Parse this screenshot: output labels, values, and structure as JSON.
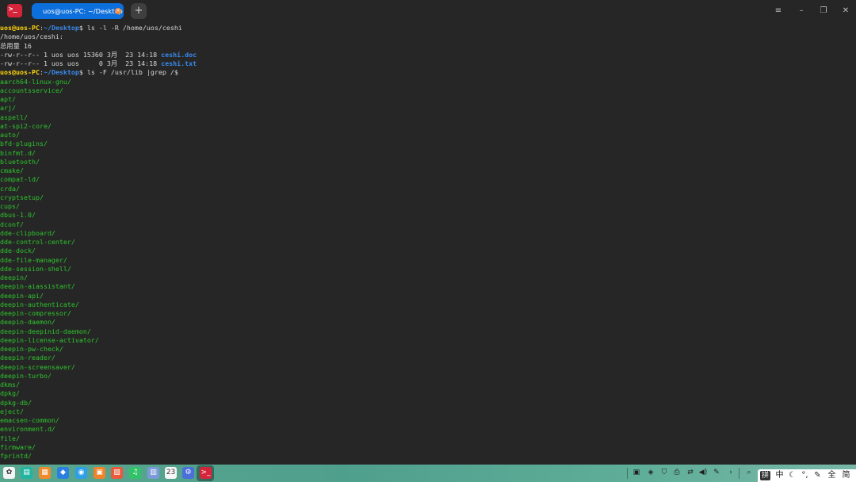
{
  "titlebar": {
    "tab_title": "uos@uos-PC: ~/Desktop",
    "new_tab_symbol": "+",
    "menu_symbol": "≡",
    "minimize_symbol": "–",
    "restore_symbol": "❐",
    "close_symbol": "✕",
    "app_icon_glyph": ">_",
    "tab_close_glyph": "×"
  },
  "terminal": {
    "prompt_user": "uos@uos-PC",
    "prompt_sep": ":",
    "prompt_path": "~/Desktop",
    "prompt_dollar": "$ ",
    "command_1": "ls -l -R /home/uos/ceshi",
    "dir_header": "/home/uos/ceshi:",
    "total_line": "总用量 16",
    "file_1_meta": "-rw-r--r-- 1 uos uos 15360 3月  23 14:18 ",
    "file_1_name": "ceshi.doc",
    "file_2_meta": "-rw-r--r-- 1 uos uos     0 3月  23 14:18 ",
    "file_2_name": "ceshi.txt",
    "command_2": "ls -F /usr/lib |grep /$",
    "dir_entries": [
      "aarch64-linux-gnu/",
      "accountsservice/",
      "apt/",
      "arj/",
      "aspell/",
      "at-spi2-core/",
      "auto/",
      "bfd-plugins/",
      "binfmt.d/",
      "bluetooth/",
      "cmake/",
      "compat-ld/",
      "crda/",
      "cryptsetup/",
      "cups/",
      "dbus-1.0/",
      "dconf/",
      "dde-clipboard/",
      "dde-control-center/",
      "dde-dock/",
      "dde-file-manager/",
      "dde-session-shell/",
      "deepin/",
      "deepin-aiassistant/",
      "deepin-api/",
      "deepin-authenticate/",
      "deepin-compressor/",
      "deepin-daemon/",
      "deepin-deepinid-daemon/",
      "deepin-license-activator/",
      "deepin-pw-check/",
      "deepin-reader/",
      "deepin-screensaver/",
      "deepin-turbo/",
      "dkms/",
      "dpkg/",
      "dpkg-db/",
      "eject/",
      "emacsen-common/",
      "environment.d/",
      "file/",
      "firmware/",
      "fprintd/"
    ]
  },
  "taskbar": {
    "apps": [
      {
        "name": "launcher",
        "glyph": "✿",
        "color": "#f4f4f4"
      },
      {
        "name": "multitasking",
        "glyph": "▤",
        "color": "#21b4a0"
      },
      {
        "name": "file-manager",
        "glyph": "▦",
        "color": "#f08a2a"
      },
      {
        "name": "app-store",
        "glyph": "◆",
        "color": "#2a7fe0"
      },
      {
        "name": "browser",
        "glyph": "◉",
        "color": "#2fa0e8"
      },
      {
        "name": "appstore-orange",
        "glyph": "▣",
        "color": "#f0822a"
      },
      {
        "name": "image-viewer",
        "glyph": "▨",
        "color": "#e85a3a"
      },
      {
        "name": "music",
        "glyph": "♫",
        "color": "#32c36a"
      },
      {
        "name": "document-viewer",
        "glyph": "▥",
        "color": "#7a9ad8"
      },
      {
        "name": "calendar",
        "glyph": "23",
        "color": "#f6f6f6"
      },
      {
        "name": "control-center",
        "glyph": "⚙",
        "color": "#4a6fd8"
      },
      {
        "name": "terminal",
        "glyph": ">_",
        "color": "#d6243b"
      }
    ],
    "tray": [
      {
        "name": "screenshot",
        "glyph": "▣"
      },
      {
        "name": "security",
        "glyph": "◈"
      },
      {
        "name": "shield",
        "glyph": "⛉"
      },
      {
        "name": "printer",
        "glyph": "⎙"
      },
      {
        "name": "network",
        "glyph": "⇄"
      },
      {
        "name": "volume",
        "glyph": "◀)"
      },
      {
        "name": "pen",
        "glyph": "✎"
      },
      {
        "name": "expand",
        "glyph": "›"
      },
      {
        "name": "search",
        "glyph": "⌕"
      }
    ],
    "ime": [
      "拼",
      "中",
      "☾",
      "°,",
      "✎",
      "全",
      "简"
    ]
  }
}
